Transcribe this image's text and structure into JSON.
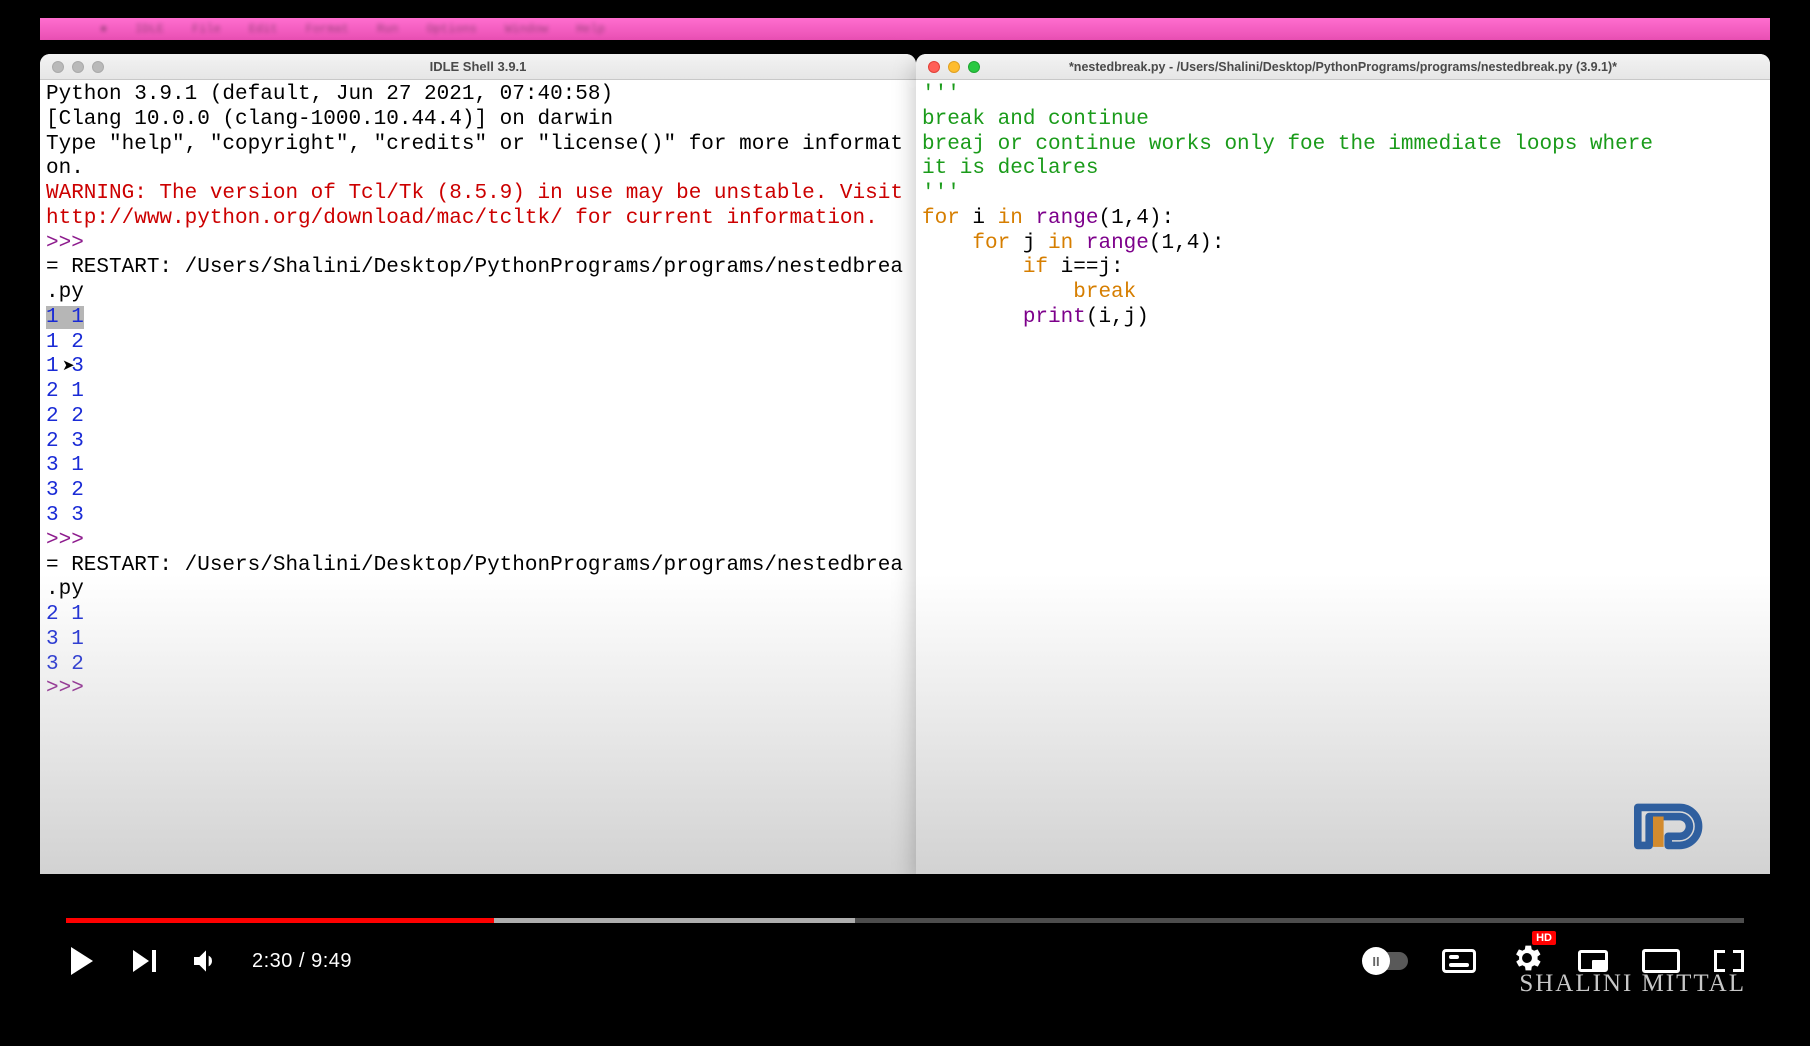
{
  "video": {
    "current_time": "2:30",
    "duration": "9:49",
    "progress_percent": 25.5,
    "hd_label": "HD",
    "autoplay_label": "II",
    "watermark": "SHALINI MITTAL"
  },
  "shell": {
    "title": "IDLE Shell 3.9.1",
    "banner_line1": "Python 3.9.1 (default, Jun 27 2021, 07:40:58) ",
    "banner_line2": "[Clang 10.0.0 (clang-1000.10.44.4)] on darwin",
    "banner_line3": "Type \"help\", \"copyright\", \"credits\" or \"license()\" for more informat",
    "banner_line3b": "on.",
    "warn_line1": "WARNING: The version of Tcl/Tk (8.5.9) in use may be unstable. Visit",
    "warn_line2": "http://www.python.org/download/mac/tcltk/ for current information.",
    "prompt": ">>> ",
    "restart1a": "= RESTART: /Users/Shalini/Desktop/PythonPrograms/programs/nestedbrea",
    "restart1b": ".py",
    "out1": [
      "1 1",
      "1 2",
      "1 3",
      "2 1",
      "2 2",
      "2 3",
      "3 1",
      "3 2",
      "3 3"
    ],
    "restart2a": "= RESTART: /Users/Shalini/Desktop/PythonPrograms/programs/nestedbrea",
    "restart2b": ".py",
    "out2": [
      "2 1",
      "3 1",
      "3 2"
    ]
  },
  "editor": {
    "title": "*nestedbreak.py - /Users/Shalini/Desktop/PythonPrograms/programs/nestedbreak.py (3.9.1)*",
    "doc_open": "'''",
    "doc_line1": "break and continue",
    "doc_line2": "breaj or continue works only foe the immediate loops where",
    "doc_line3": "it is declares",
    "doc_close": "'''",
    "kw_for": "for",
    "kw_in": "in",
    "kw_if": "if",
    "kw_break": "break",
    "fn_range": "range",
    "fn_print": "print",
    "line_for_i_tail": " i ",
    "range_args": "(1,4):",
    "line_for_j_pre": "    ",
    "line_for_j_tail": " j ",
    "line_if_pre": "        ",
    "line_if_tail": " i==j:",
    "line_break_pre": "            ",
    "line_print_pre": "        ",
    "print_args": "(i,j)"
  }
}
